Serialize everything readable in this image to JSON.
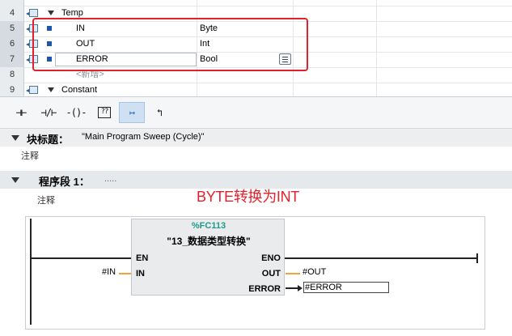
{
  "table": {
    "rows": [
      {
        "num": "4",
        "name": "Temp",
        "type": "",
        "kind": "section"
      },
      {
        "num": "5",
        "name": "IN",
        "type": "Byte",
        "kind": "var"
      },
      {
        "num": "6",
        "name": "OUT",
        "type": "Int",
        "kind": "var"
      },
      {
        "num": "7",
        "name": "ERROR",
        "type": "Bool",
        "kind": "var"
      },
      {
        "num": "8",
        "name": "<新增>",
        "type": "",
        "kind": "add"
      },
      {
        "num": "9",
        "name": "Constant",
        "type": "",
        "kind": "section"
      }
    ]
  },
  "toolbar": {
    "buttons": [
      {
        "glyph": "⊣⊢",
        "name": "no-contact-button"
      },
      {
        "glyph": "⊣/⊢",
        "name": "nc-contact-button"
      },
      {
        "glyph": "-()-",
        "name": "coil-button"
      },
      {
        "glyph": "??",
        "name": "empty-box-button"
      },
      {
        "glyph": "↦",
        "name": "open-branch-button"
      },
      {
        "glyph": "↰",
        "name": "close-branch-button"
      }
    ]
  },
  "block": {
    "title_label": "块标题：",
    "title_value": "\"Main Program Sweep (Cycle)\"",
    "comment": "注释"
  },
  "network": {
    "label": "程序段 1：",
    "dots": ".....",
    "comment": "注释",
    "annotation": "BYTE转换为INT"
  },
  "function_block": {
    "instance": "%FC113",
    "name": "\"13_数据类型转换\"",
    "pin_en": "EN",
    "pin_in": "IN",
    "pin_eno": "ENO",
    "pin_out": "OUT",
    "pin_error": "ERROR",
    "operand_in": "#IN",
    "operand_out": "#OUT",
    "operand_error": "#ERROR"
  },
  "colors": {
    "annotation": "#e4202a",
    "wire_orange": "#f2a23a",
    "instance_text": "#1f9a8a"
  }
}
